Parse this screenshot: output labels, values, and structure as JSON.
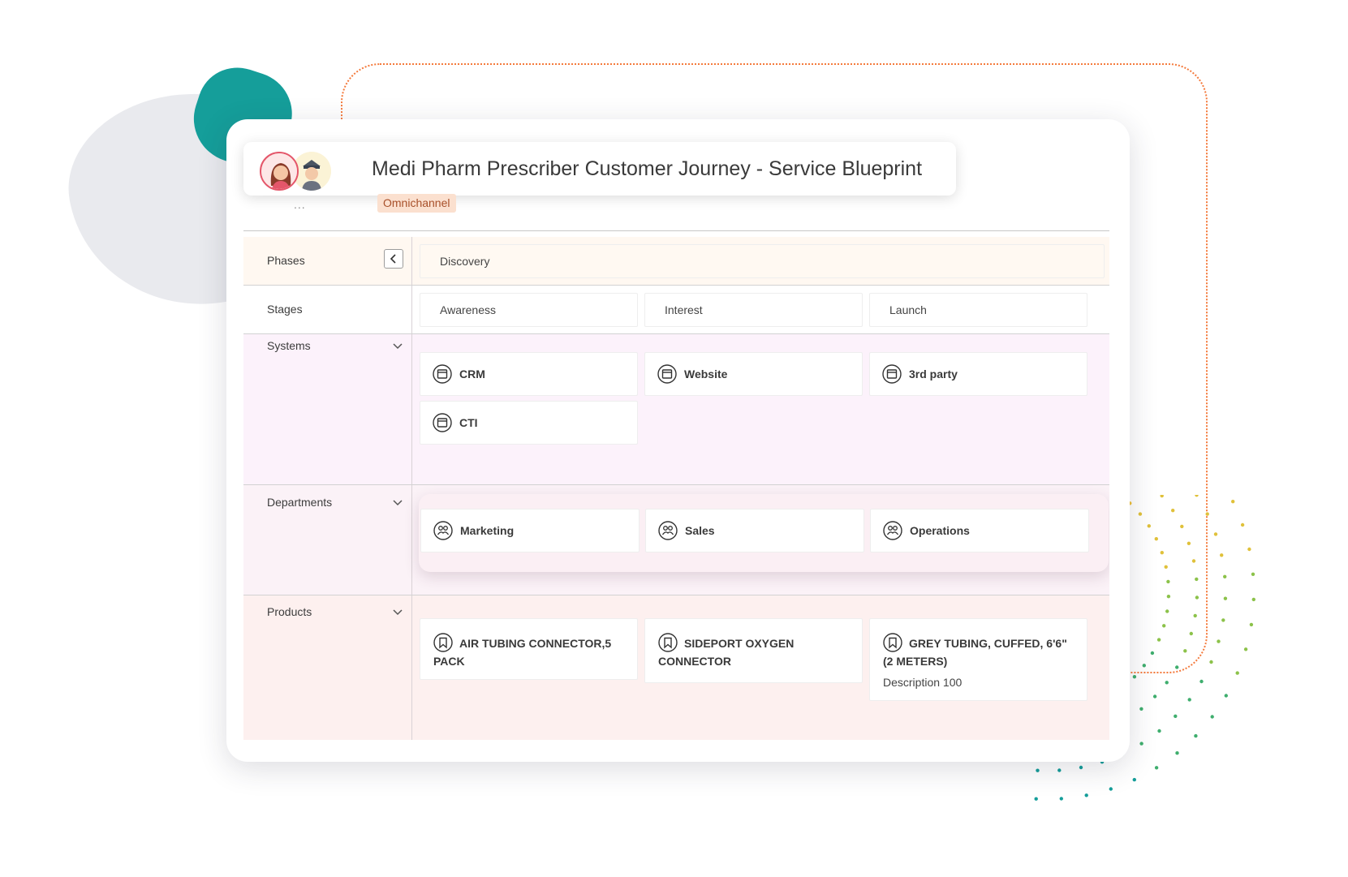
{
  "header": {
    "title": "Medi Pharm Prescriber Customer Journey - Service Blueprint",
    "more": "...",
    "tag": "Omnichannel"
  },
  "rows": {
    "phases": {
      "label": "Phases",
      "values": [
        "Discovery"
      ]
    },
    "stages": {
      "label": "Stages",
      "values": [
        "Awareness",
        "Interest",
        "Launch"
      ]
    },
    "systems": {
      "label": "Systems",
      "items": [
        "CRM",
        "Website",
        "3rd party",
        "CTI"
      ]
    },
    "departments": {
      "label": "Departments",
      "items": [
        "Marketing",
        "Sales",
        "Operations"
      ]
    },
    "products": {
      "label": "Products",
      "items": [
        {
          "name_line1": "AIR TUBING CONNECTOR,5",
          "name_line2": "PACK",
          "description": ""
        },
        {
          "name_line1": "SIDEPORT OXYGEN",
          "name_line2": "CONNECTOR",
          "description": ""
        },
        {
          "name_line1": "GREY TUBING, CUFFED, 6'6\"",
          "name_line2": "(2 METERS)",
          "description": "Description 100"
        }
      ]
    }
  },
  "icons": {
    "system": "browser-window-icon",
    "department": "people-group-icon",
    "product": "bookmark-icon",
    "collapse": "chevron-left-icon",
    "expand": "chevron-down-icon"
  },
  "colors": {
    "accent_teal": "#159e9a",
    "accent_orange": "#f47a3c",
    "tag_bg": "#fbe0cf",
    "phase_bg": "#fff8f1",
    "systems_bg": "#fcf2fb",
    "departments_bg": "#fbf2f7",
    "products_bg": "#fdf0ef"
  }
}
